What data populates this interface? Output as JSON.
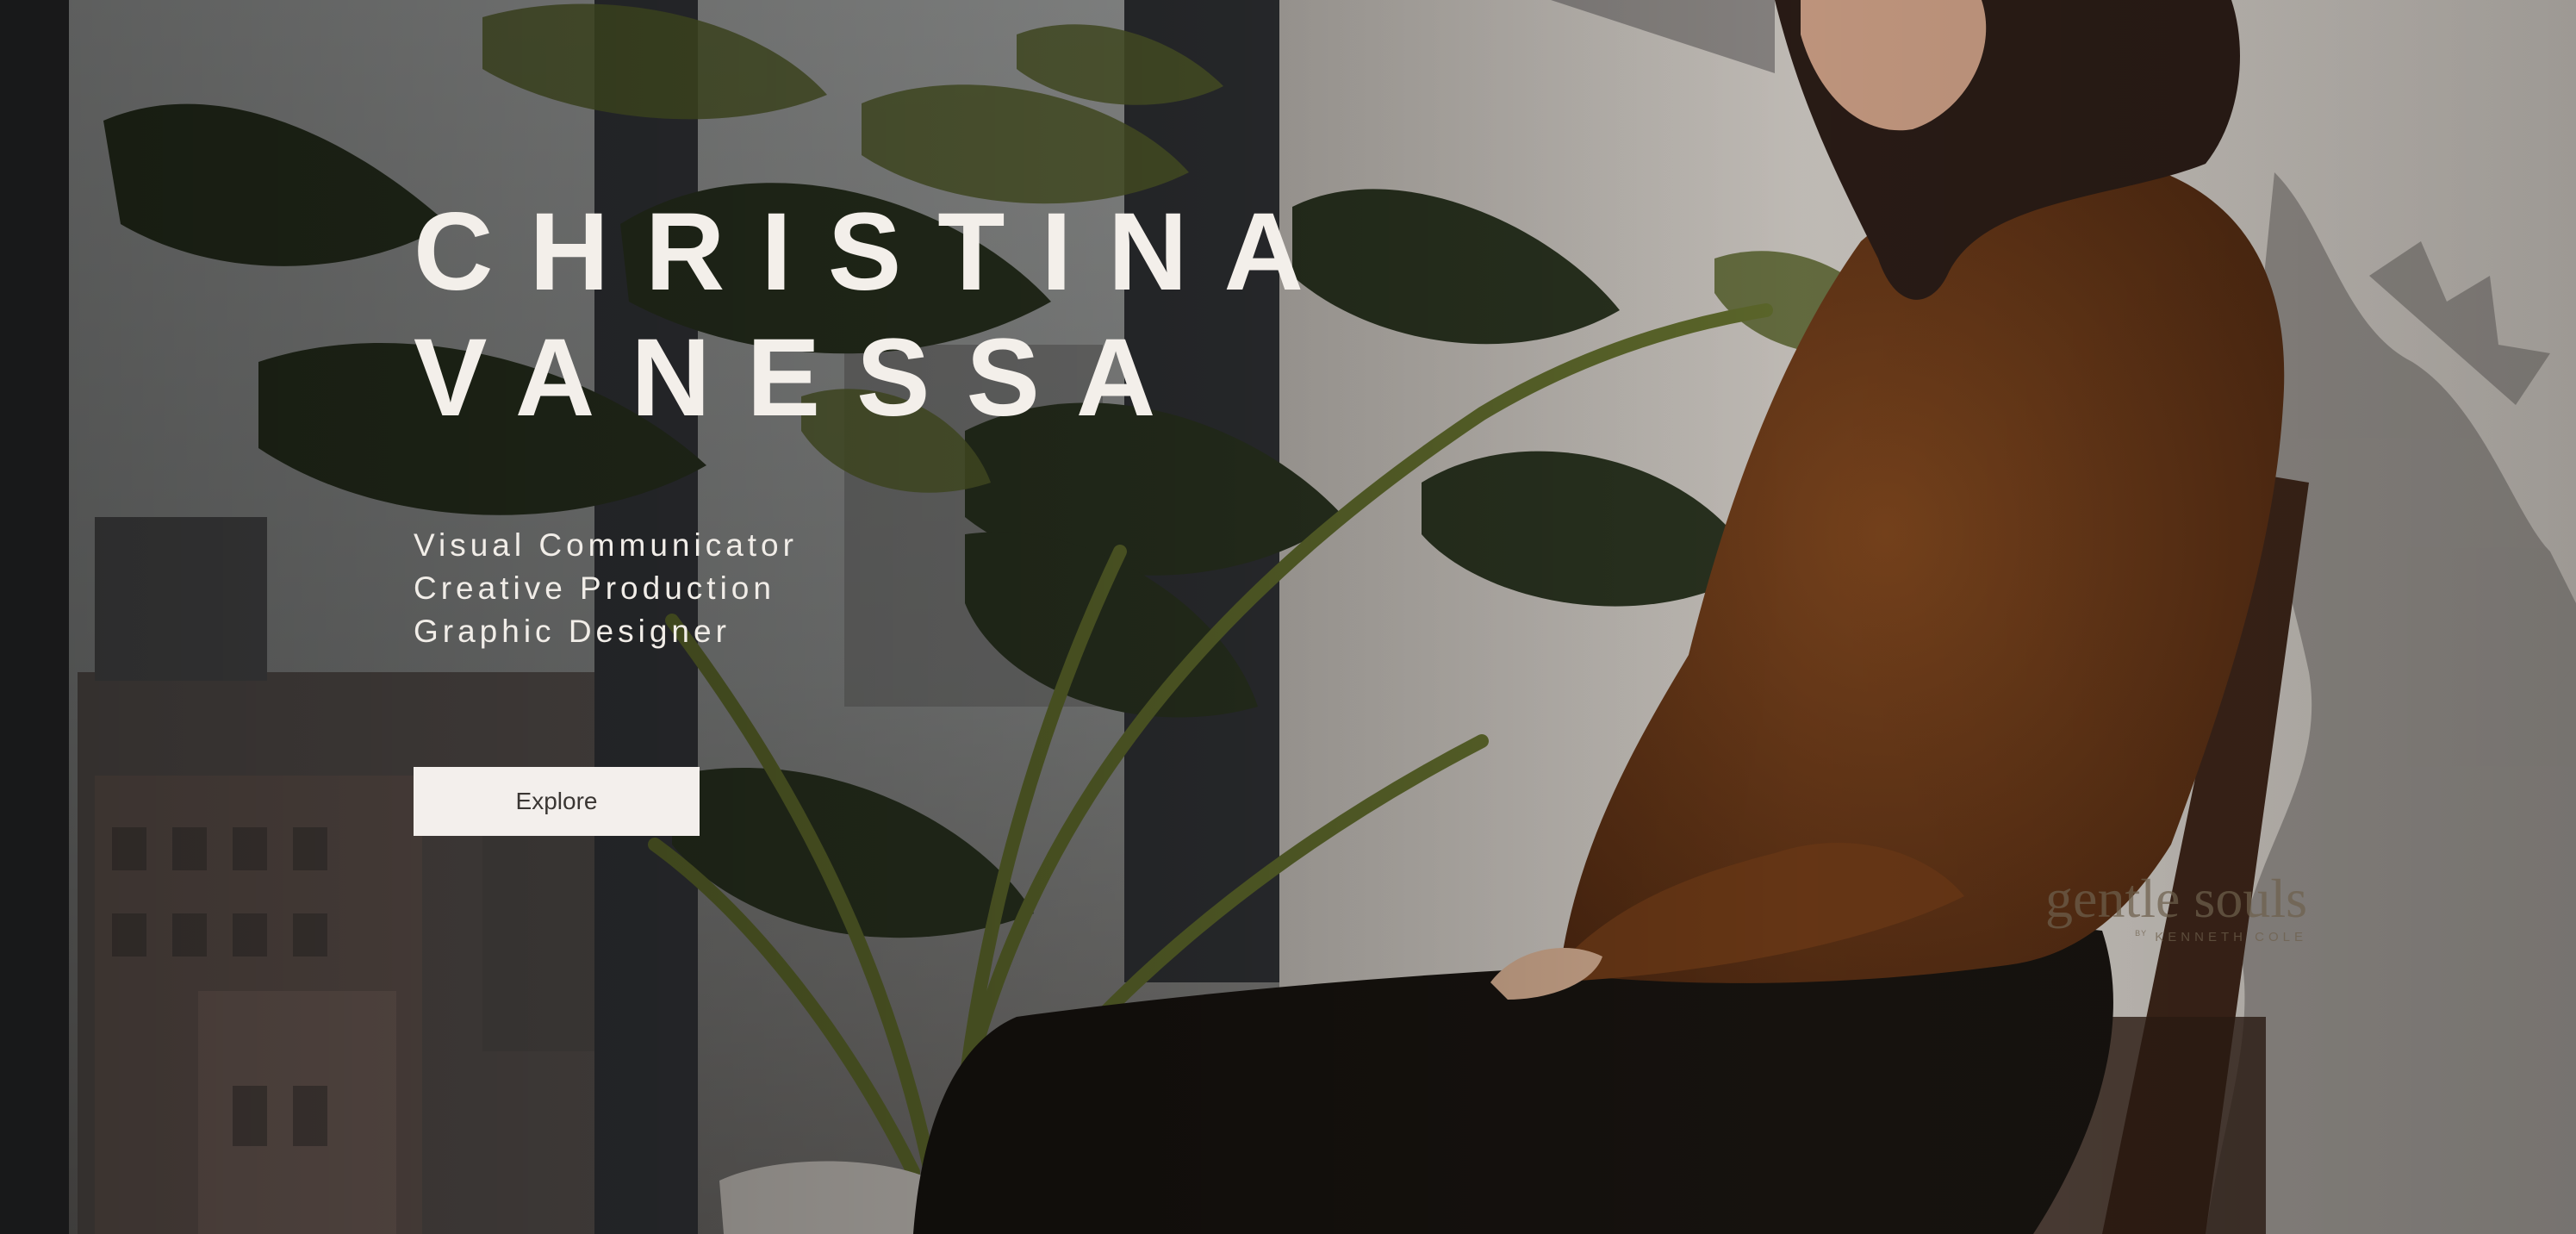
{
  "hero": {
    "name_line_1": "CHRISTINA",
    "name_line_2": "VANESSA",
    "roles": [
      "Visual Communicator",
      "Creative Production",
      "Graphic Designer"
    ],
    "cta_label": "Explore"
  },
  "background_brand": {
    "name": "gentle souls",
    "by": "BY",
    "sub": "KENNETH COLE"
  },
  "colors": {
    "headline": "#f3efea",
    "button_bg": "#f3efec",
    "button_text": "#3a3633",
    "sweater": "#6b3a18",
    "wall": "#c9c4bd"
  }
}
